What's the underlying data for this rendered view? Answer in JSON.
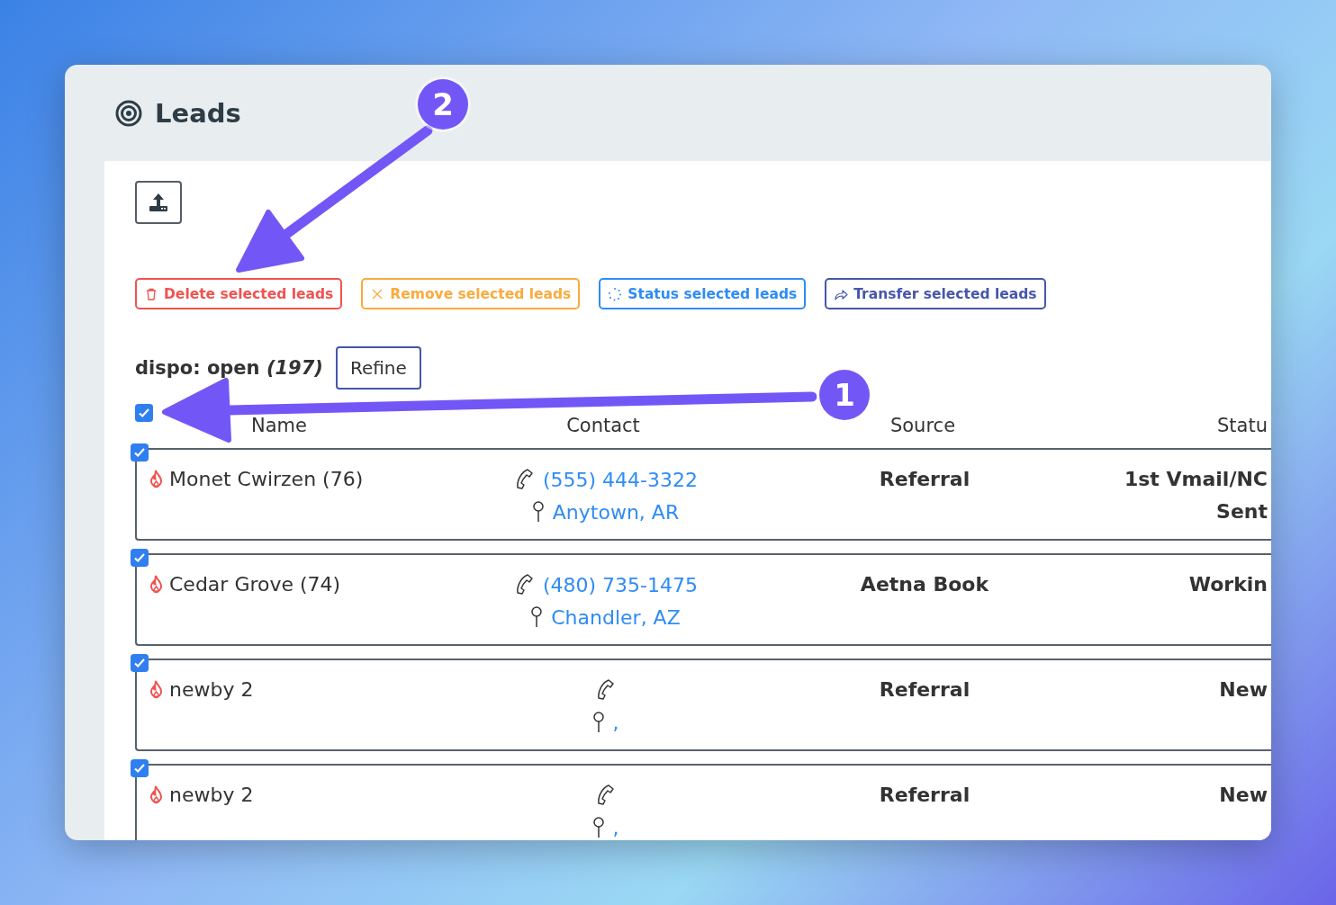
{
  "page": {
    "title": "Leads"
  },
  "actions": [
    {
      "kind": "delete",
      "label": "Delete selected leads"
    },
    {
      "kind": "remove",
      "label": "Remove selected leads"
    },
    {
      "kind": "status",
      "label": "Status selected leads"
    },
    {
      "kind": "transfer",
      "label": "Transfer selected leads"
    }
  ],
  "filter": {
    "text": "dispo: open *(197)*",
    "button": "Refine"
  },
  "select_all": {
    "checked": true
  },
  "columns": [
    "Name",
    "Contact",
    "Source",
    "Statu"
  ],
  "rows": [
    {
      "checked": true,
      "name": "Monet Cwirzen (76)",
      "phone": "(555) 444-3322",
      "location": "Anytown, AR",
      "source": "Referral",
      "status": "1st Vmail/NC Sent"
    },
    {
      "checked": true,
      "name": "Cedar Grove (74)",
      "phone": "(480) 735-1475",
      "location": "Chandler, AZ",
      "source": "Aetna Book",
      "status": "Workin"
    },
    {
      "checked": true,
      "name": "newby 2",
      "location": ",",
      "source": "Referral",
      "status": "New"
    },
    {
      "checked": true,
      "name": "newby 2",
      "location": ",",
      "source": "Referral",
      "status": "New"
    }
  ],
  "annotations": [
    {
      "label": "2"
    },
    {
      "label": "1"
    }
  ]
}
